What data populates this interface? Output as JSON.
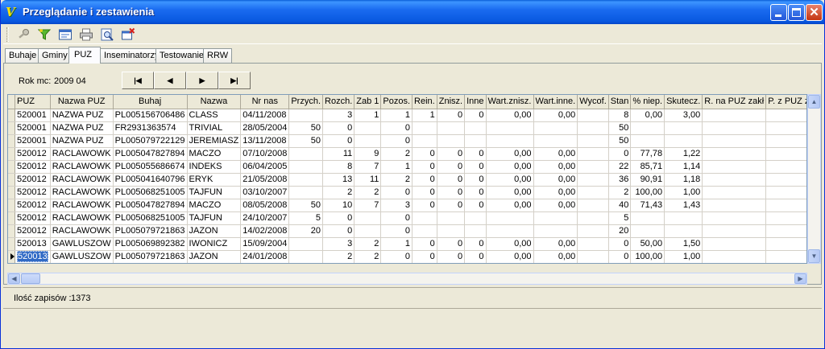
{
  "window": {
    "title": "Przeglądanie i zestawienia"
  },
  "tabs": [
    "Buhaje",
    "Gminy",
    "PUZ",
    "Inseminatorzy",
    "Testowanie",
    "RRW"
  ],
  "active_tab": "PUZ",
  "filter": {
    "label": "Rok mc:",
    "value": "2009 04"
  },
  "nav": {
    "first": "|◀",
    "prev": "◀",
    "next": "▶",
    "last": "▶|"
  },
  "grid": {
    "columns": [
      "PUZ",
      "Nazwa PUZ",
      "Buhaj",
      "Nazwa",
      "Nr nas",
      "Przych.",
      "Rozch.",
      "Zab 1",
      "Pozos.",
      "Rein.",
      "Znisz.",
      "Inne",
      "Wart.znisz.",
      "Wart.inne.",
      "Wycof.",
      "Stan",
      "% niep.",
      "Skutecz.",
      "R. na PUZ zakł",
      "P. z PUZ zakł"
    ],
    "rows": [
      [
        "520001",
        "NAZWA PUZ",
        "PL005156706486",
        "CLASS",
        "04/11/2008",
        "",
        "3",
        "1",
        "1",
        "1",
        "0",
        "0",
        "0,00",
        "0,00",
        "",
        "8",
        "0,00",
        "3,00",
        "",
        ""
      ],
      [
        "520001",
        "NAZWA PUZ",
        "FR2931363574",
        "TRIVIAL",
        "28/05/2004",
        "50",
        "0",
        "",
        "0",
        "",
        "",
        "",
        "",
        "",
        "",
        "50",
        "",
        "",
        "",
        ""
      ],
      [
        "520001",
        "NAZWA PUZ",
        "PL005079722129",
        "JEREMIASZ",
        "13/11/2008",
        "50",
        "0",
        "",
        "0",
        "",
        "",
        "",
        "",
        "",
        "",
        "50",
        "",
        "",
        "",
        ""
      ],
      [
        "520012",
        "RACLAWOWK",
        "PL005047827894",
        "MACZO",
        "07/10/2008",
        "",
        "11",
        "9",
        "2",
        "0",
        "0",
        "0",
        "0,00",
        "0,00",
        "",
        "0",
        "77,78",
        "1,22",
        "",
        ""
      ],
      [
        "520012",
        "RACLAWOWK",
        "PL005055686674",
        "INDEKS",
        "06/04/2005",
        "",
        "8",
        "7",
        "1",
        "0",
        "0",
        "0",
        "0,00",
        "0,00",
        "",
        "22",
        "85,71",
        "1,14",
        "",
        ""
      ],
      [
        "520012",
        "RACLAWOWK",
        "PL005041640796",
        "ERYK",
        "21/05/2008",
        "",
        "13",
        "11",
        "2",
        "0",
        "0",
        "0",
        "0,00",
        "0,00",
        "",
        "36",
        "90,91",
        "1,18",
        "",
        ""
      ],
      [
        "520012",
        "RACLAWOWK",
        "PL005068251005",
        "TAJFUN",
        "03/10/2007",
        "",
        "2",
        "2",
        "0",
        "0",
        "0",
        "0",
        "0,00",
        "0,00",
        "",
        "2",
        "100,00",
        "1,00",
        "",
        ""
      ],
      [
        "520012",
        "RACLAWOWK",
        "PL005047827894",
        "MACZO",
        "08/05/2008",
        "50",
        "10",
        "7",
        "3",
        "0",
        "0",
        "0",
        "0,00",
        "0,00",
        "",
        "40",
        "71,43",
        "1,43",
        "",
        ""
      ],
      [
        "520012",
        "RACLAWOWK",
        "PL005068251005",
        "TAJFUN",
        "24/10/2007",
        "5",
        "0",
        "",
        "0",
        "",
        "",
        "",
        "",
        "",
        "",
        "5",
        "",
        "",
        "",
        ""
      ],
      [
        "520012",
        "RACLAWOWK",
        "PL005079721863",
        "JAZON",
        "14/02/2008",
        "20",
        "0",
        "",
        "0",
        "",
        "",
        "",
        "",
        "",
        "",
        "20",
        "",
        "",
        "",
        ""
      ],
      [
        "520013",
        "GAWLUSZOW",
        "PL005069892382",
        "IWONICZ",
        "15/09/2004",
        "",
        "3",
        "2",
        "1",
        "0",
        "0",
        "0",
        "0,00",
        "0,00",
        "",
        "0",
        "50,00",
        "1,50",
        "",
        ""
      ],
      [
        "520013",
        "GAWLUSZOW",
        "PL005079721863",
        "JAZON",
        "24/01/2008",
        "",
        "2",
        "2",
        "0",
        "0",
        "0",
        "0",
        "0,00",
        "0,00",
        "",
        "0",
        "100,00",
        "1,00",
        "",
        ""
      ]
    ],
    "selected_row": 11
  },
  "status": {
    "count_label": "Ilość zapisów :",
    "count_value": "1373"
  },
  "toolbar_icons": [
    "key-icon",
    "filter-icon",
    "report-icon",
    "print-icon",
    "preview-icon",
    "close-window-icon"
  ],
  "colors": {
    "title_blue": "#0858e0",
    "selection": "#316ac5"
  }
}
